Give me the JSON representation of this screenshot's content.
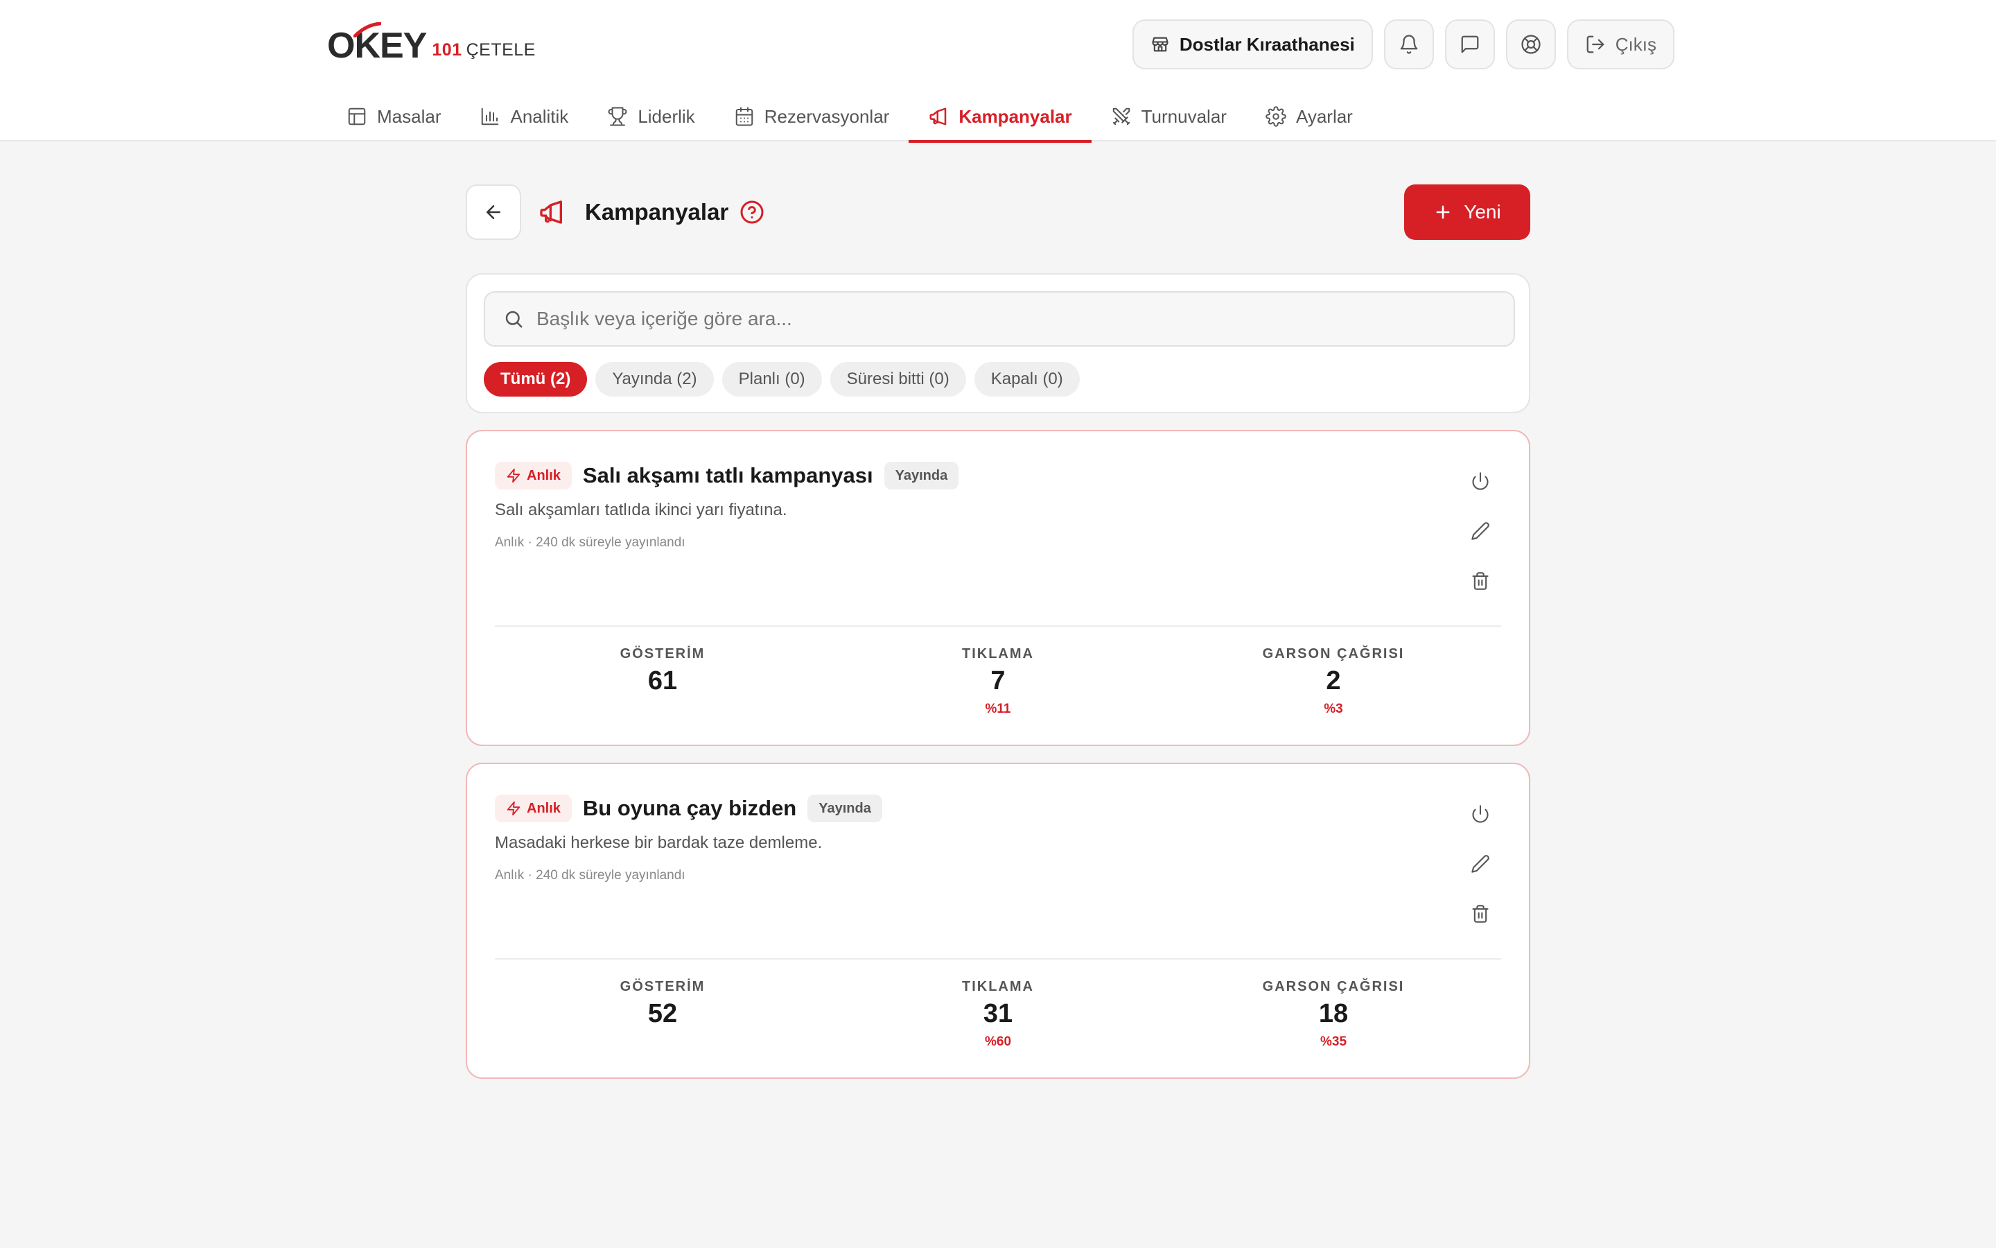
{
  "brand": {
    "logo_main": "OKEY",
    "logo_num": "101",
    "logo_sub": "ÇETELE",
    "accent": "#d71f26"
  },
  "header": {
    "venue": "Dostlar Kıraathanesi",
    "logout": "Çıkış"
  },
  "nav": {
    "items": [
      {
        "label": "Masalar",
        "icon": "table-icon"
      },
      {
        "label": "Analitik",
        "icon": "bar-chart-icon"
      },
      {
        "label": "Liderlik",
        "icon": "trophy-icon"
      },
      {
        "label": "Rezervasyonlar",
        "icon": "calendar-icon"
      },
      {
        "label": "Kampanyalar",
        "icon": "megaphone-icon",
        "active": true
      },
      {
        "label": "Turnuvalar",
        "icon": "swords-icon"
      },
      {
        "label": "Ayarlar",
        "icon": "gear-icon"
      }
    ]
  },
  "page": {
    "title": "Kampanyalar",
    "new_button": "Yeni"
  },
  "search": {
    "placeholder": "Başlık veya içeriğe göre ara...",
    "value": ""
  },
  "filters": [
    {
      "label": "Tümü (2)",
      "active": true
    },
    {
      "label": "Yayında (2)"
    },
    {
      "label": "Planlı (0)"
    },
    {
      "label": "Süresi bitti (0)"
    },
    {
      "label": "Kapalı (0)"
    }
  ],
  "campaigns": [
    {
      "type": "Anlık",
      "title": "Salı akşamı tatlı kampanyası",
      "status": "Yayında",
      "description": "Salı akşamları tatlıda ikinci yarı fiyatına.",
      "meta": "Anlık · 240 dk süreyle yayınlandı",
      "stats": [
        {
          "label": "GÖSTERİM",
          "value": "61",
          "pct": ""
        },
        {
          "label": "TIKLAMA",
          "value": "7",
          "pct": "%11"
        },
        {
          "label": "GARSON ÇAĞRISI",
          "value": "2",
          "pct": "%3"
        }
      ]
    },
    {
      "type": "Anlık",
      "title": "Bu oyuna çay bizden",
      "status": "Yayında",
      "description": "Masadaki herkese bir bardak taze demleme.",
      "meta": "Anlık · 240 dk süreyle yayınlandı",
      "stats": [
        {
          "label": "GÖSTERİM",
          "value": "52",
          "pct": ""
        },
        {
          "label": "TIKLAMA",
          "value": "31",
          "pct": "%60"
        },
        {
          "label": "GARSON ÇAĞRISI",
          "value": "18",
          "pct": "%35"
        }
      ]
    }
  ]
}
